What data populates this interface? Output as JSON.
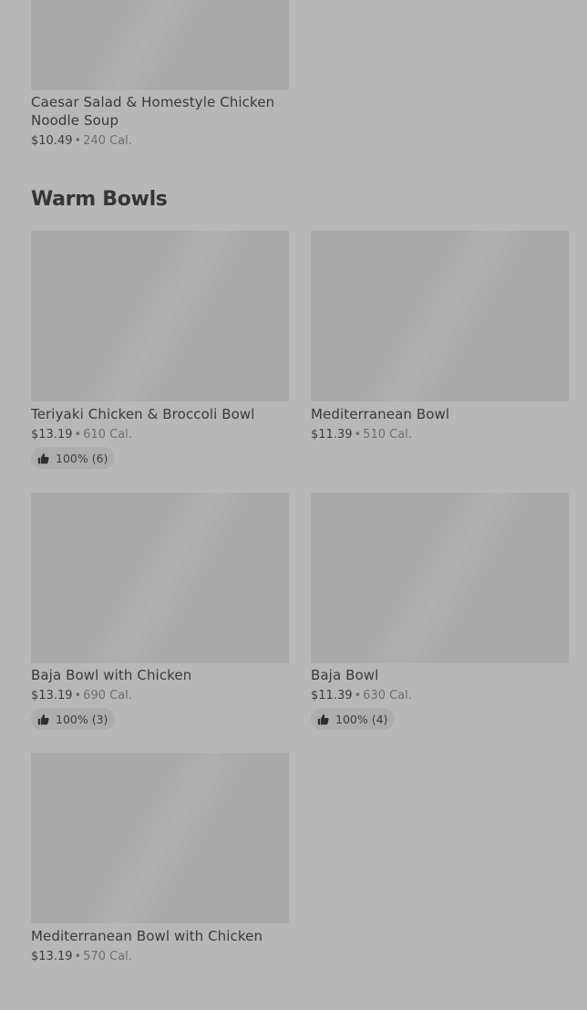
{
  "top_item": {
    "name": "Caesar Salad & Homestyle Chicken Noodle Soup",
    "price": "$10.49",
    "calories": "240 Cal."
  },
  "section": {
    "title": "Warm Bowls"
  },
  "items": [
    {
      "name": "Teriyaki Chicken & Broccoli Bowl",
      "price": "$13.19",
      "calories": "610 Cal.",
      "rating": "100% (6)"
    },
    {
      "name": "Mediterranean Bowl",
      "price": "$11.39",
      "calories": "510 Cal.",
      "rating": null
    },
    {
      "name": "Baja Bowl with Chicken",
      "price": "$13.19",
      "calories": "690 Cal.",
      "rating": "100% (3)"
    },
    {
      "name": "Baja Bowl",
      "price": "$11.39",
      "calories": "630 Cal.",
      "rating": "100% (4)"
    },
    {
      "name": "Mediterranean Bowl with Chicken",
      "price": "$13.19",
      "calories": "570 Cal.",
      "rating": null
    }
  ],
  "separator": "•",
  "icons": {
    "rating": "thumbs-up-icon"
  },
  "colors": {
    "background": "#b7b7b7",
    "image_placeholder": "#a9a9a9",
    "rating_pill": "#adadad"
  }
}
